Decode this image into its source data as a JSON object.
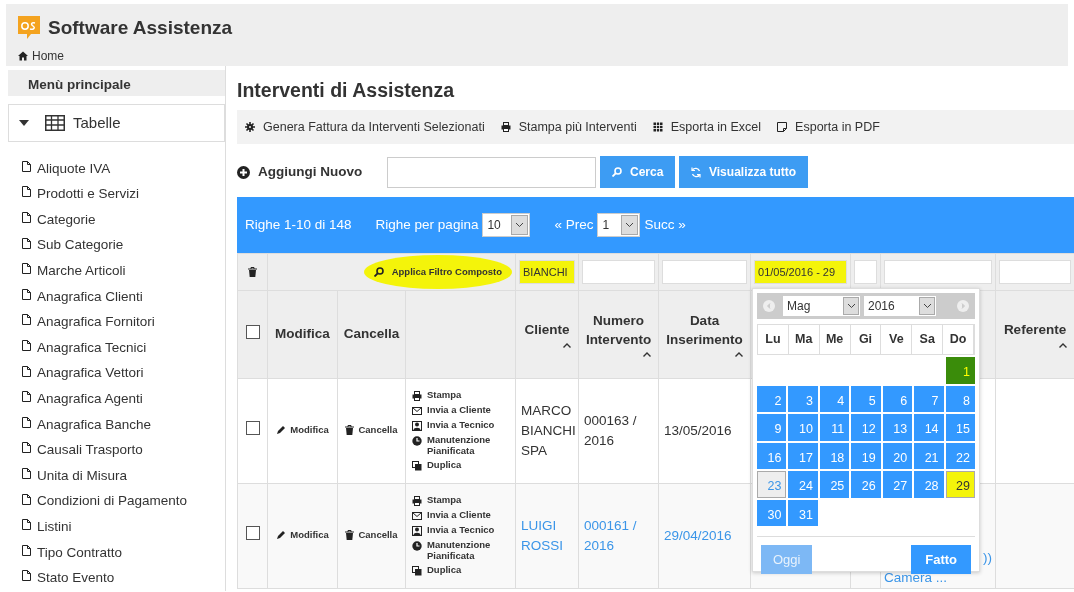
{
  "app": {
    "title": "Software Assistenza",
    "breadcrumb": "Home"
  },
  "sidebar": {
    "heading": "Menù principale",
    "group": {
      "label": "Tabelle",
      "expanded": true
    },
    "items": [
      "Aliquote IVA",
      "Prodotti e Servizi",
      "Categorie",
      "Sub Categorie",
      "Marche Articoli",
      "Anagrafica Clienti",
      "Anagrafica Fornitori",
      "Anagrafica Tecnici",
      "Anagrafica Vettori",
      "Anagrafica Agenti",
      "Anagrafica Banche",
      "Causali Trasporto",
      "Unita di Misura",
      "Condizioni di Pagamento",
      "Listini",
      "Tipo Contratto",
      "Stato Evento"
    ]
  },
  "page_title": "Interventi di Assistenza",
  "toolbar": [
    {
      "kind": "gear",
      "label": "Genera Fattura da Interventi Selezionati"
    },
    {
      "kind": "print",
      "label": "Stampa più Interventi"
    },
    {
      "kind": "excel",
      "label": "Esporta in Excel"
    },
    {
      "kind": "pdf",
      "label": "Esporta in PDF"
    }
  ],
  "add_button": "Aggiungi Nuovo",
  "search_button": "Cerca",
  "show_all_button": "Visualizza tutto",
  "pager": {
    "range": "Righe 1-10 di 148",
    "per_page_label": "Righe per pagina",
    "per_page": "10",
    "prev": "« Prec",
    "page": "1",
    "next": "Succ »"
  },
  "filter": {
    "apply_button": "Applica Filtro Composto",
    "apply_highlighted": true,
    "fields": [
      {
        "value": "BIANCHI",
        "highlighted": true
      },
      {
        "highlighted": false
      },
      {
        "highlighted": false
      },
      {
        "value": "01/05/2016 - 29",
        "highlighted": true
      },
      {
        "highlighted": false
      },
      {
        "highlighted": false
      },
      {
        "highlighted": false
      }
    ]
  },
  "columns": [
    {
      "kind": "checkbox",
      "checked": false
    },
    {
      "kind": "text",
      "label": "Modifica"
    },
    {
      "kind": "text",
      "label": "Cancella"
    },
    {
      "kind": "blank"
    },
    {
      "kind": "text",
      "label": "Cliente",
      "sortable": true
    },
    {
      "kind": "text",
      "label": "Numero Intervento",
      "sortable": true
    },
    {
      "kind": "text",
      "label": "Data Inserimento",
      "sortable": true
    },
    {
      "kind": "blank"
    },
    {
      "kind": "blank"
    },
    {
      "kind": "blank"
    },
    {
      "kind": "text",
      "label": "Referente",
      "sortable": true
    }
  ],
  "rows": [
    {
      "checked": false,
      "link": false,
      "edit": "Modifica",
      "delete": "Cancella",
      "actions": [
        {
          "kind": "print",
          "label": "Stampa"
        },
        {
          "kind": "mail",
          "label": "Invia a Cliente"
        },
        {
          "kind": "tech",
          "label": "Invia a Tecnico"
        },
        {
          "kind": "clock",
          "label": "Manutenzione Pianificata"
        },
        {
          "kind": "copy",
          "label": "Duplica"
        }
      ],
      "cliente": "MARCO BIANCHI SPA",
      "numero": "000163 / 2016",
      "data": "13/05/2016"
    },
    {
      "checked": false,
      "link": true,
      "edit": "Modifica",
      "delete": "Cancella",
      "actions": [
        {
          "kind": "print",
          "label": "Stampa"
        },
        {
          "kind": "mail",
          "label": "Invia a Cliente"
        },
        {
          "kind": "tech",
          "label": "Invia a Tecnico"
        },
        {
          "kind": "clock",
          "label": "Manutenzione Pianificata"
        },
        {
          "kind": "copy",
          "label": "Duplica"
        }
      ],
      "cliente": "LUIGI ROSSI",
      "numero": "000161 / 2016",
      "data": "29/04/2016",
      "column_10": [
        "))",
        "Camera ..."
      ]
    }
  ],
  "calendar": {
    "month": "Mag",
    "year": "2016",
    "weekdays": [
      "Lu",
      "Ma",
      "Me",
      "Gi",
      "Ve",
      "Sa",
      "Do"
    ],
    "weeks": [
      [
        {
          "kind": "blank"
        },
        {
          "kind": "blank"
        },
        {
          "kind": "blank"
        },
        {
          "kind": "blank"
        },
        {
          "kind": "blank"
        },
        {
          "kind": "blank"
        },
        {
          "kind": "day",
          "label": "1",
          "range_start": true,
          "range_end": false,
          "today": false
        }
      ],
      [
        {
          "kind": "day",
          "label": "2",
          "range_start": false,
          "range_end": false,
          "today": false
        },
        {
          "kind": "day",
          "label": "3",
          "range_start": false,
          "range_end": false,
          "today": false
        },
        {
          "kind": "day",
          "label": "4",
          "range_start": false,
          "range_end": false,
          "today": false
        },
        {
          "kind": "day",
          "label": "5",
          "range_start": false,
          "range_end": false,
          "today": false
        },
        {
          "kind": "day",
          "label": "6",
          "range_start": false,
          "range_end": false,
          "today": false
        },
        {
          "kind": "day",
          "label": "7",
          "range_start": false,
          "range_end": false,
          "today": false
        },
        {
          "kind": "day",
          "label": "8",
          "range_start": false,
          "range_end": false,
          "today": false
        }
      ],
      [
        {
          "kind": "day",
          "label": "9",
          "range_start": false,
          "range_end": false,
          "today": false
        },
        {
          "kind": "day",
          "label": "10",
          "range_start": false,
          "range_end": false,
          "today": false
        },
        {
          "kind": "day",
          "label": "11",
          "range_start": false,
          "range_end": false,
          "today": false
        },
        {
          "kind": "day",
          "label": "12",
          "range_start": false,
          "range_end": false,
          "today": false
        },
        {
          "kind": "day",
          "label": "13",
          "range_start": false,
          "range_end": false,
          "today": false
        },
        {
          "kind": "day",
          "label": "14",
          "range_start": false,
          "range_end": false,
          "today": false
        },
        {
          "kind": "day",
          "label": "15",
          "range_start": false,
          "range_end": false,
          "today": false
        }
      ],
      [
        {
          "kind": "day",
          "label": "16",
          "range_start": false,
          "range_end": false,
          "today": false
        },
        {
          "kind": "day",
          "label": "17",
          "range_start": false,
          "range_end": false,
          "today": false
        },
        {
          "kind": "day",
          "label": "18",
          "range_start": false,
          "range_end": false,
          "today": false
        },
        {
          "kind": "day",
          "label": "19",
          "range_start": false,
          "range_end": false,
          "today": false
        },
        {
          "kind": "day",
          "label": "20",
          "range_start": false,
          "range_end": false,
          "today": false
        },
        {
          "kind": "day",
          "label": "21",
          "range_start": false,
          "range_end": false,
          "today": false
        },
        {
          "kind": "day",
          "label": "22",
          "range_start": false,
          "range_end": false,
          "today": false
        }
      ],
      [
        {
          "kind": "day",
          "label": "23",
          "range_start": false,
          "range_end": false,
          "today": true
        },
        {
          "kind": "day",
          "label": "24",
          "range_start": false,
          "range_end": false,
          "today": false
        },
        {
          "kind": "day",
          "label": "25",
          "range_start": false,
          "range_end": false,
          "today": false
        },
        {
          "kind": "day",
          "label": "26",
          "range_start": false,
          "range_end": false,
          "today": false
        },
        {
          "kind": "day",
          "label": "27",
          "range_start": false,
          "range_end": false,
          "today": false
        },
        {
          "kind": "day",
          "label": "28",
          "range_start": false,
          "range_end": false,
          "today": false
        },
        {
          "kind": "day",
          "label": "29",
          "range_start": false,
          "range_end": true,
          "today": false
        }
      ],
      [
        {
          "kind": "day",
          "label": "30",
          "range_start": false,
          "range_end": false,
          "today": false
        },
        {
          "kind": "day",
          "label": "31",
          "range_start": false,
          "range_end": false,
          "today": false
        },
        {
          "kind": "blank"
        },
        {
          "kind": "blank"
        },
        {
          "kind": "blank"
        },
        {
          "kind": "blank"
        },
        {
          "kind": "blank"
        }
      ]
    ],
    "today_button": {
      "label": "Oggi",
      "disabled": true
    },
    "done_button": "Fatto"
  }
}
